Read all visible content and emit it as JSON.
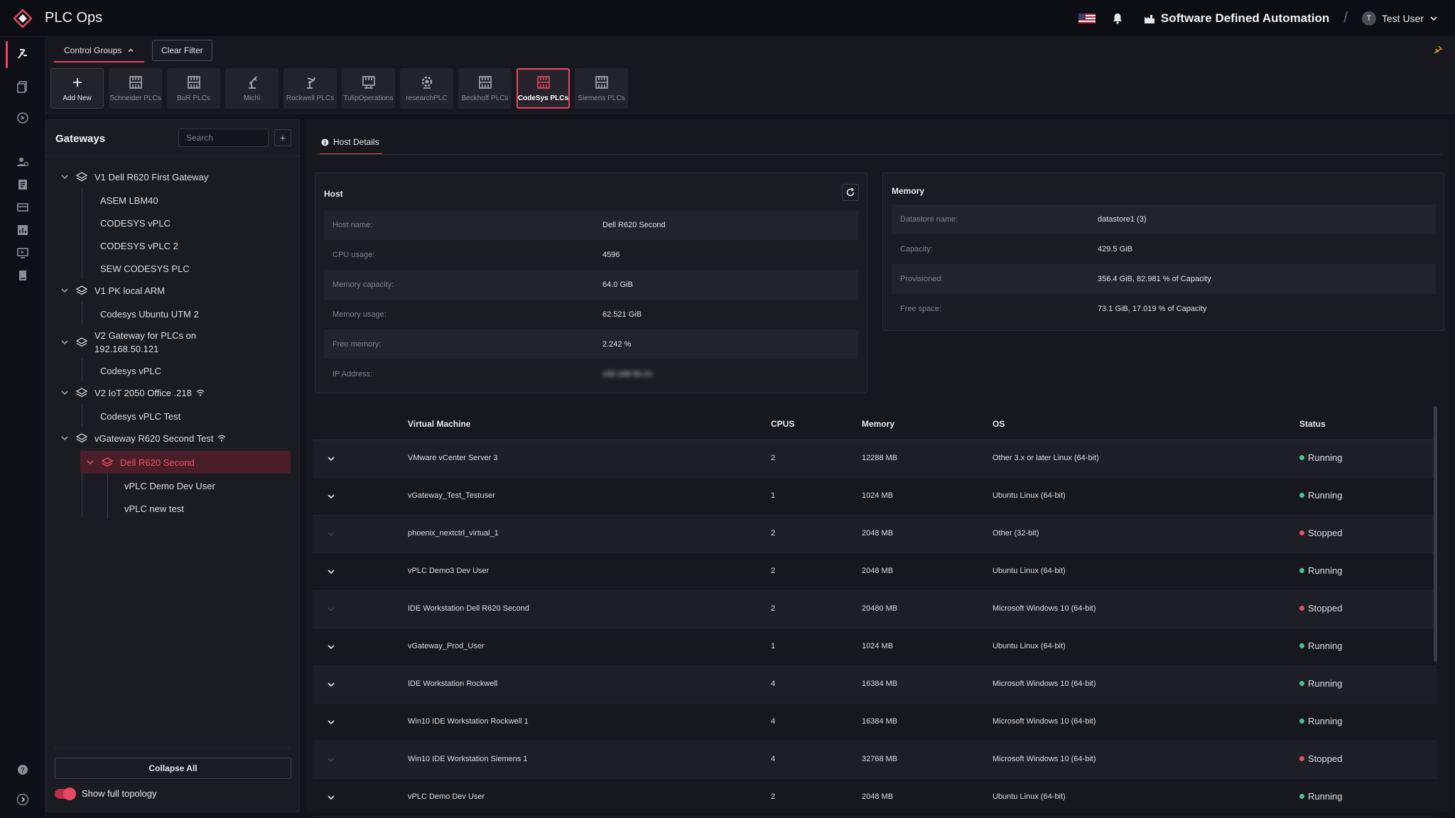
{
  "app": {
    "title": "PLC Ops"
  },
  "header": {
    "project": "Software Defined Automation",
    "separator": "/",
    "user_initial": "T",
    "user_name": "Test User"
  },
  "toolbar": {
    "control_groups_label": "Control Groups",
    "clear_filter_label": "Clear Filter",
    "groups": [
      {
        "label": "Add New",
        "icon": "plus-icon"
      },
      {
        "label": "Schneider PLCs",
        "icon": "plc-icon"
      },
      {
        "label": "BuR PLCs",
        "icon": "plc-icon"
      },
      {
        "label": "Michi",
        "icon": "robot-arm-icon"
      },
      {
        "label": "Rockwell PLCs",
        "icon": "robot-arm-icon"
      },
      {
        "label": "TulipOperations",
        "icon": "plc-icon"
      },
      {
        "label": "researchPLC",
        "icon": "gear-icon"
      },
      {
        "label": "Beckhoff PLCs",
        "icon": "plc-icon"
      },
      {
        "label": "CodeSys PLCs",
        "icon": "plc-icon",
        "active": true
      },
      {
        "label": "Siemens PLCs",
        "icon": "plc-icon"
      }
    ]
  },
  "gateways": {
    "title": "Gateways",
    "search_placeholder": "Search",
    "add_label": "+",
    "tree": [
      {
        "label": "V1 Dell R620 First Gateway",
        "children": [
          "ASEM LBM40",
          "CODESYS vPLC",
          "CODESYS vPLC 2",
          "SEW CODESYS PLC"
        ]
      },
      {
        "label": "V1 PK local ARM",
        "children": [
          "Codesys Ubuntu UTM 2"
        ]
      },
      {
        "label_line1": "V2 Gateway for PLCs on",
        "label_line2": "192.168.50.121",
        "children": [
          "Codesys vPLC"
        ]
      },
      {
        "label": "V2 IoT 2050 Office .218",
        "children": [
          "Codesys vPLC Test"
        ]
      },
      {
        "label": "vGateway R620 Second Test",
        "children": []
      }
    ],
    "selected_host": "Dell R620 Second",
    "selected_host_children": [
      "vPLC Demo Dev User",
      "vPLC new test"
    ],
    "collapse_all_label": "Collapse All",
    "show_topology_label": "Show full topology",
    "show_topology_on": true
  },
  "main": {
    "tab_label": "Host Details",
    "host_card": {
      "title": "Host",
      "rows": [
        {
          "key": "Host name:",
          "value": "Dell R620 Second"
        },
        {
          "key": "CPU usage:",
          "value": "4596"
        },
        {
          "key": "Memory capacity:",
          "value": "64.0 GiB"
        },
        {
          "key": "Memory usage:",
          "value": "62.521 GiB"
        },
        {
          "key": "Free memory:",
          "value": "2.242 %"
        },
        {
          "key": "IP Address:",
          "value": "192.168.50.21"
        }
      ]
    },
    "memory_card": {
      "title": "Memory",
      "rows": [
        {
          "key": "Datastore name:",
          "value": "datastore1 (3)"
        },
        {
          "key": "Capacity:",
          "value": "429.5 GiB"
        },
        {
          "key": "Provisioned:",
          "value": "356.4 GiB, 82.981 % of Capacity"
        },
        {
          "key": "Free space:",
          "value": "73.1 GiB, 17.019 % of Capacity"
        }
      ]
    },
    "vm_table": {
      "headers": [
        "Virtual Machine",
        "CPUS",
        "Memory",
        "OS",
        "Status"
      ],
      "rows": [
        {
          "name": "VMware vCenter Server 3",
          "cpus": "2",
          "memory": "12288 MB",
          "os": "Other 3.x or later Linux (64-bit)",
          "status": "Running"
        },
        {
          "name": "vGateway_Test_Testuser",
          "cpus": "1",
          "memory": "1024 MB",
          "os": "Ubuntu Linux (64-bit)",
          "status": "Running"
        },
        {
          "name": "phoenix_nextctrl_virtual_1",
          "cpus": "2",
          "memory": "2048 MB",
          "os": "Other (32-bit)",
          "status": "Stopped"
        },
        {
          "name": "vPLC Demo3 Dev User",
          "cpus": "2",
          "memory": "2048 MB",
          "os": "Ubuntu Linux (64-bit)",
          "status": "Running"
        },
        {
          "name": "IDE Workstation Dell R620 Second",
          "cpus": "2",
          "memory": "20480 MB",
          "os": "Microsoft Windows 10 (64-bit)",
          "status": "Stopped"
        },
        {
          "name": "vGateway_Prod_User",
          "cpus": "1",
          "memory": "1024 MB",
          "os": "Ubuntu Linux (64-bit)",
          "status": "Running"
        },
        {
          "name": "IDE Workstation Rockwell",
          "cpus": "4",
          "memory": "16384 MB",
          "os": "Microsoft Windows 10 (64-bit)",
          "status": "Running"
        },
        {
          "name": "Win10 IDE Workstation Rockwell 1",
          "cpus": "4",
          "memory": "16384 MB",
          "os": "Microsoft Windows 10 (64-bit)",
          "status": "Running"
        },
        {
          "name": "Win10 IDE Workstation Siemens 1",
          "cpus": "4",
          "memory": "32768 MB",
          "os": "Microsoft Windows 10 (64-bit)",
          "status": "Stopped"
        },
        {
          "name": "vPLC Demo Dev User",
          "cpus": "2",
          "memory": "2048 MB",
          "os": "Ubuntu Linux (64-bit)",
          "status": "Running"
        }
      ]
    }
  },
  "colors": {
    "accent": "#e64862",
    "running": "#4cc38a",
    "stopped": "#e0566a"
  }
}
